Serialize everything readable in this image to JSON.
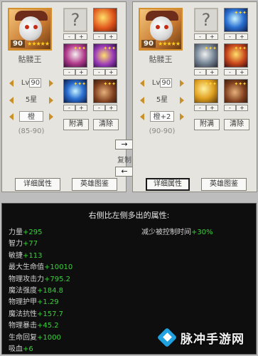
{
  "colors": {
    "stat_value": "#3ad23a",
    "arrow": "#c9902a",
    "stats_bg": "#0e0e0e",
    "panel_bg": "#e6e4de"
  },
  "left": {
    "level_badge": "90",
    "hero_name": "骷髅王",
    "level_text": "Lv",
    "level_value": "90",
    "stars": "5星",
    "quality": "橙",
    "range": "(85-90)",
    "empty_slot": "?",
    "attach_label": "附满",
    "clear_label": "清除"
  },
  "right": {
    "level_badge": "90",
    "hero_name": "骷髅王",
    "level_text": "Lv",
    "level_value": "90",
    "stars": "5星",
    "quality": "橙+2",
    "range": "(90-90)",
    "empty_slot": "?",
    "attach_label": "附满",
    "clear_label": "清除"
  },
  "pm": {
    "minus": "-",
    "plus": "+"
  },
  "center": {
    "arrow_right": "→",
    "copy": "复制",
    "arrow_left": "←"
  },
  "bottom_buttons": {
    "left_detail": "详细属性",
    "left_guide": "英雄图鉴",
    "right_detail": "详细属性",
    "right_guide": "英雄图鉴"
  },
  "stats": {
    "heading": "右侧比左侧多出的属性:",
    "right_column": {
      "label": "减少被控制时间",
      "value": "+30%"
    },
    "lines": [
      {
        "label": "力量",
        "value": "+295"
      },
      {
        "label": "智力",
        "value": "+77"
      },
      {
        "label": "敏捷",
        "value": "+113"
      },
      {
        "label": "最大生命值",
        "value": "+10010"
      },
      {
        "label": "物理攻击力",
        "value": "+795.2"
      },
      {
        "label": "魔法强度",
        "value": "+184.8"
      },
      {
        "label": "物理护甲",
        "value": "+1.29"
      },
      {
        "label": "魔法抗性",
        "value": "+157.7"
      },
      {
        "label": "物理暴击",
        "value": "+45.2"
      },
      {
        "label": "生命回复",
        "value": "+1000"
      },
      {
        "label": "吸血",
        "value": "+6"
      }
    ]
  },
  "watermark": {
    "text": "脉冲手游网"
  }
}
